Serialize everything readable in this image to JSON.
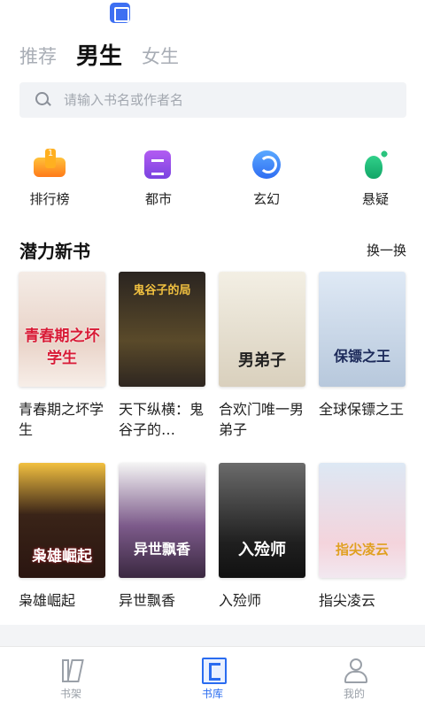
{
  "tabs": [
    {
      "label": "推荐",
      "active": false
    },
    {
      "label": "男生",
      "active": true
    },
    {
      "label": "女生",
      "active": false
    }
  ],
  "search": {
    "placeholder": "请输入书名或作者名"
  },
  "categories": [
    {
      "label": "排行榜",
      "icon": "trophy-icon"
    },
    {
      "label": "都市",
      "icon": "city-icon"
    },
    {
      "label": "玄幻",
      "icon": "yin-yang-icon"
    },
    {
      "label": "悬疑",
      "icon": "footprint-icon"
    }
  ],
  "section": {
    "title": "潜力新书",
    "action": "换一换"
  },
  "books": [
    {
      "title": "青春期之坏学生",
      "cover_text": "青春期之坏学生"
    },
    {
      "title": "天下纵横：鬼谷子的…",
      "cover_text": "鬼谷子的局"
    },
    {
      "title": "合欢门唯一男弟子",
      "cover_text": "男弟子"
    },
    {
      "title": "全球保镖之王",
      "cover_text": "保镖之王"
    },
    {
      "title": "枭雄崛起",
      "cover_text": "枭雄崛起"
    },
    {
      "title": "异世飘香",
      "cover_text": "异世飘香"
    },
    {
      "title": "入殓师",
      "cover_text": "入殓师"
    },
    {
      "title": "指尖凌云",
      "cover_text": "指尖凌云"
    }
  ],
  "nav": [
    {
      "label": "书架",
      "icon": "bookshelf-icon",
      "active": false
    },
    {
      "label": "书库",
      "icon": "library-icon",
      "active": true
    },
    {
      "label": "我的",
      "icon": "profile-icon",
      "active": false
    }
  ],
  "colors": {
    "accent": "#2a6cf0",
    "inactive": "#9aa0a8",
    "search_bg": "#f1f3f6"
  }
}
